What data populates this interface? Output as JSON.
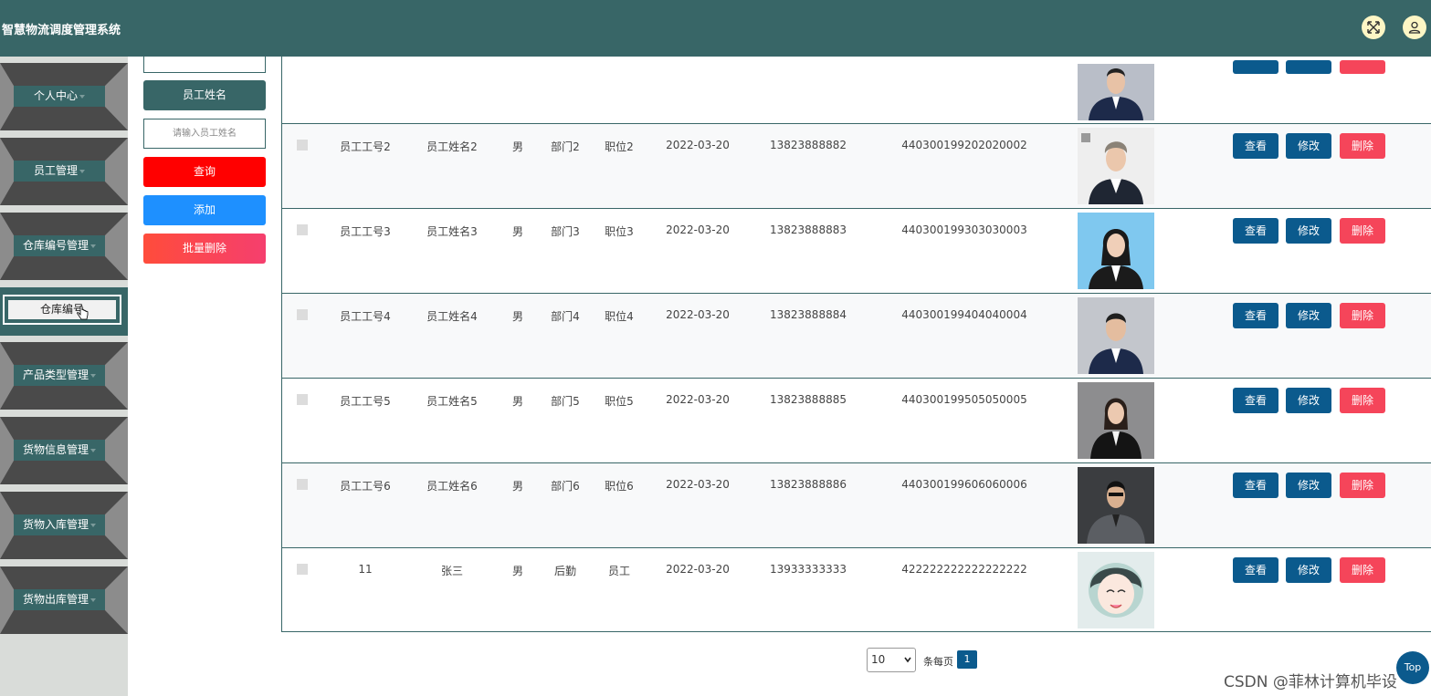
{
  "app": {
    "title": "智慧物流调度管理系统"
  },
  "header": {
    "fullscreen_icon": "expand-icon",
    "user_icon": "user-icon"
  },
  "sidebar": {
    "items": [
      {
        "label": "个人中心"
      },
      {
        "label": "员工管理"
      },
      {
        "label": "仓库编号管理"
      },
      {
        "label": "产品类型管理"
      },
      {
        "label": "货物信息管理"
      },
      {
        "label": "货物入库管理"
      },
      {
        "label": "货物出库管理"
      }
    ],
    "active_sub": "仓库编号"
  },
  "filter": {
    "field_label": "员工姓名",
    "placeholder": "请输入员工姓名",
    "query_label": "查询",
    "add_label": "添加",
    "batch_delete_label": "批量删除"
  },
  "table": {
    "rows": [
      {
        "id": "员工工号2",
        "name": "员工姓名2",
        "gender": "男",
        "dept": "部门2",
        "pos": "职位2",
        "date": "2022-03-20",
        "phone": "13823888882",
        "idcard": "440300199202020002"
      },
      {
        "id": "员工工号3",
        "name": "员工姓名3",
        "gender": "男",
        "dept": "部门3",
        "pos": "职位3",
        "date": "2022-03-20",
        "phone": "13823888883",
        "idcard": "440300199303030003"
      },
      {
        "id": "员工工号4",
        "name": "员工姓名4",
        "gender": "男",
        "dept": "部门4",
        "pos": "职位4",
        "date": "2022-03-20",
        "phone": "13823888884",
        "idcard": "440300199404040004"
      },
      {
        "id": "员工工号5",
        "name": "员工姓名5",
        "gender": "男",
        "dept": "部门5",
        "pos": "职位5",
        "date": "2022-03-20",
        "phone": "13823888885",
        "idcard": "440300199505050005"
      },
      {
        "id": "员工工号6",
        "name": "员工姓名6",
        "gender": "男",
        "dept": "部门6",
        "pos": "职位6",
        "date": "2022-03-20",
        "phone": "13823888886",
        "idcard": "440300199606060006"
      },
      {
        "id": "11",
        "name": "张三",
        "gender": "男",
        "dept": "后勤",
        "pos": "员工",
        "date": "2022-03-20",
        "phone": "13933333333",
        "idcard": "422222222222222222"
      }
    ],
    "actions": {
      "view": "查看",
      "edit": "修改",
      "delete": "删除"
    }
  },
  "pager": {
    "page_size": "10",
    "per_page_label": "条每页",
    "current_page": "1"
  },
  "top_button": "Top",
  "watermark": "CSDN @菲林计算机毕设",
  "colors": {
    "primary": "#386667",
    "action_blue": "#0b5a8d",
    "delete_red": "#f5455a",
    "query_red": "#ff0000",
    "add_blue": "#1e90ff"
  }
}
